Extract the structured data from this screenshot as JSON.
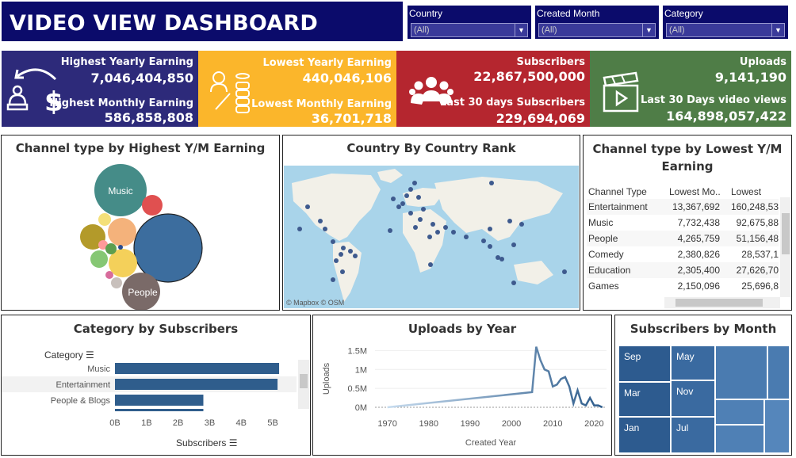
{
  "header": {
    "title": "VIDEO VIEW DASHBOARD"
  },
  "filters": [
    {
      "label": "Country",
      "value": "(All)"
    },
    {
      "label": "Created Month",
      "value": "(All)"
    },
    {
      "label": "Category",
      "value": "(All)"
    }
  ],
  "kpis": {
    "earnings_high": {
      "label1": "Highest Yearly Earning",
      "value1": "7,046,404,850",
      "label2": "Highest Monthly Earning",
      "value2": "586,858,808",
      "color": "#2d2a7a"
    },
    "earnings_low": {
      "label1": "Lowest Yearly Earning",
      "value1": "440,046,106",
      "label2": "Lowest Monthly Earning",
      "value2": "36,701,718",
      "color": "#fbb62b"
    },
    "subscribers": {
      "label1": "Subscribers",
      "value1": "22,867,500,000",
      "label2": "Last 30 days Subscribers",
      "value2": "229,694,069",
      "color": "#b5262f"
    },
    "uploads": {
      "label1": "Uploads",
      "value1": "9,141,190",
      "label2": "Last 30 Days  video views",
      "value2": "164,898,057,422",
      "color": "#4f7d47"
    }
  },
  "bubble_panel": {
    "title": "Channel type by Highest Y/M Earning",
    "labels": {
      "music": "Music",
      "people": "People"
    }
  },
  "map_panel": {
    "title": "Country By Country Rank",
    "attribution": "© Mapbox © OSM"
  },
  "table_panel": {
    "title_line1": "Channel type by Lowest Y/M",
    "title_line2": "Earning",
    "columns": [
      "Channel Type",
      "Lowest Mo..",
      "Lowest Yea"
    ],
    "rows": [
      [
        "Entertainment",
        "13,367,692",
        "160,248,53"
      ],
      [
        "Music",
        "7,732,438",
        "92,675,88"
      ],
      [
        "People",
        "4,265,759",
        "51,156,48"
      ],
      [
        "Comedy",
        "2,380,826",
        "28,537,1"
      ],
      [
        "Education",
        "2,305,400",
        "27,626,70"
      ],
      [
        "Games",
        "2,150,096",
        "25,696,8"
      ]
    ]
  },
  "category_panel": {
    "title": "Category by Subscribers",
    "field_label": "Category",
    "axis_label": "Subscribers"
  },
  "uploads_panel": {
    "title": "Uploads by Year"
  },
  "month_panel": {
    "title": "Subscribers by Month"
  },
  "chart_data": [
    {
      "type": "bar",
      "orientation": "horizontal",
      "title": "Category by Subscribers",
      "ylabel": "Category",
      "xlabel": "Subscribers",
      "categories": [
        "Music",
        "Entertainment",
        "People & Blogs"
      ],
      "values": [
        5.2,
        5.15,
        2.8
      ],
      "units": "B",
      "x_ticks": [
        "0B",
        "1B",
        "2B",
        "3B",
        "4B",
        "5B"
      ],
      "xlim": [
        0,
        5.5
      ]
    },
    {
      "type": "line",
      "title": "Uploads by Year",
      "xlabel": "Created Year",
      "ylabel": "Uploads",
      "x_ticks": [
        "1970",
        "1980",
        "1990",
        "2000",
        "2010",
        "2020"
      ],
      "y_ticks": [
        "0M",
        "0.5M",
        "1M",
        "1.5M"
      ],
      "xlim": [
        1967,
        2023
      ],
      "ylim": [
        0,
        1.55
      ],
      "x": [
        1970,
        2005,
        2006,
        2007,
        2008,
        2009,
        2010,
        2011,
        2012,
        2013,
        2014,
        2015,
        2016,
        2017,
        2018,
        2019,
        2020,
        2021,
        2022
      ],
      "y": [
        0.0,
        0.4,
        1.6,
        1.25,
        1.0,
        0.95,
        0.55,
        0.6,
        0.75,
        0.8,
        0.55,
        0.1,
        0.45,
        0.1,
        0.05,
        0.25,
        0.05,
        0.05,
        0.0
      ]
    },
    {
      "type": "treemap",
      "title": "Subscribers by Month",
      "labels": [
        "Sep",
        "May",
        "Mar",
        "Nov",
        "Jan",
        "Jul"
      ]
    }
  ]
}
